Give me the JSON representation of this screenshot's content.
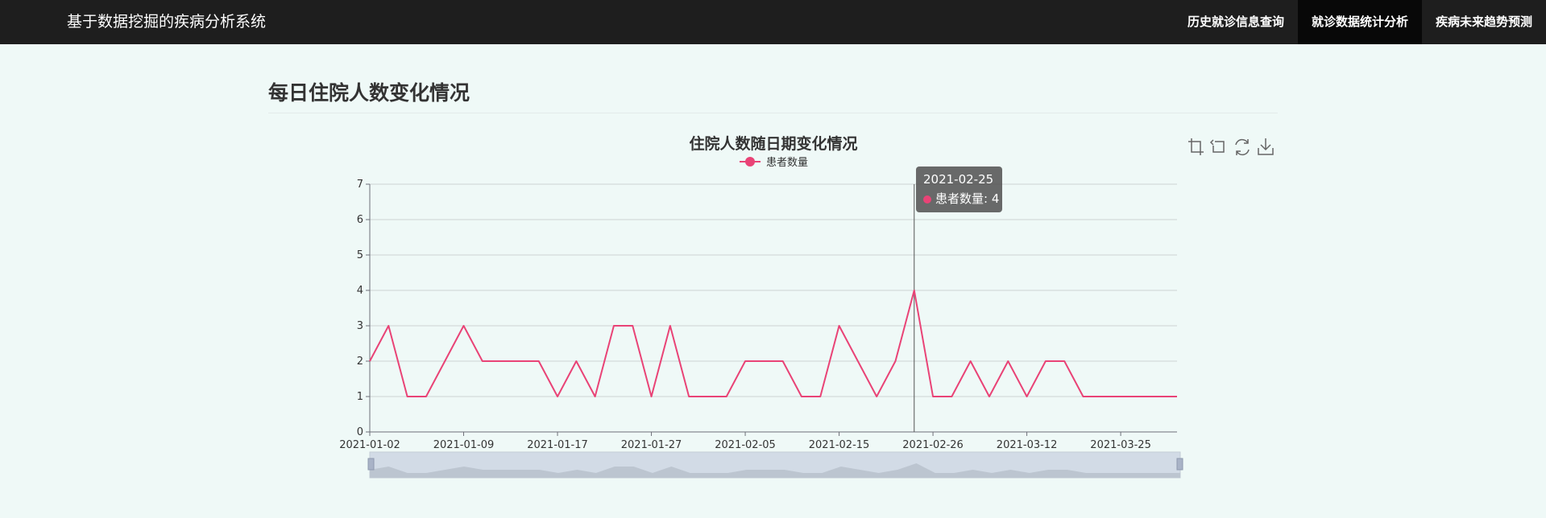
{
  "navbar": {
    "brand": "基于数据挖掘的疾病分析系统",
    "items": [
      {
        "label": "历史就诊信息查询",
        "active": false
      },
      {
        "label": "就诊数据统计分析",
        "active": true
      },
      {
        "label": "疾病未来趋势预测",
        "active": false
      }
    ]
  },
  "page": {
    "heading": "每日住院人数变化情况"
  },
  "toolbox": [
    "zoom-select-icon",
    "zoom-reset-icon",
    "restore-icon",
    "download-icon"
  ],
  "tooltip": {
    "date": "2021-02-25",
    "label": "患者数量: 4"
  },
  "chart_data": {
    "type": "line",
    "title": "住院人数随日期变化情况",
    "xlabel": "",
    "ylabel": "",
    "ylim": [
      0,
      7
    ],
    "yticks": [
      0,
      1,
      2,
      3,
      4,
      5,
      6,
      7
    ],
    "grid": true,
    "legend_position": "top-center",
    "x_tick_labels": [
      "2021-01-02",
      "2021-01-09",
      "2021-01-17",
      "2021-01-27",
      "2021-02-05",
      "2021-02-15",
      "2021-02-26",
      "2021-03-12",
      "2021-03-25"
    ],
    "x_tick_indices": [
      0,
      5,
      10,
      15,
      20,
      25,
      30,
      35,
      40
    ],
    "series": [
      {
        "name": "患者数量",
        "color": "#e94376",
        "values": [
          2,
          3,
          1,
          1,
          2,
          3,
          2,
          2,
          2,
          2,
          1,
          2,
          1,
          3,
          3,
          1,
          3,
          1,
          1,
          1,
          2,
          2,
          2,
          1,
          1,
          3,
          2,
          1,
          2,
          4,
          1,
          1,
          2,
          1,
          2,
          1,
          2,
          2,
          1,
          1,
          1,
          1,
          1,
          1
        ]
      }
    ],
    "highlight_index": 29,
    "datazoom": {
      "start": 0,
      "end": 100
    }
  }
}
